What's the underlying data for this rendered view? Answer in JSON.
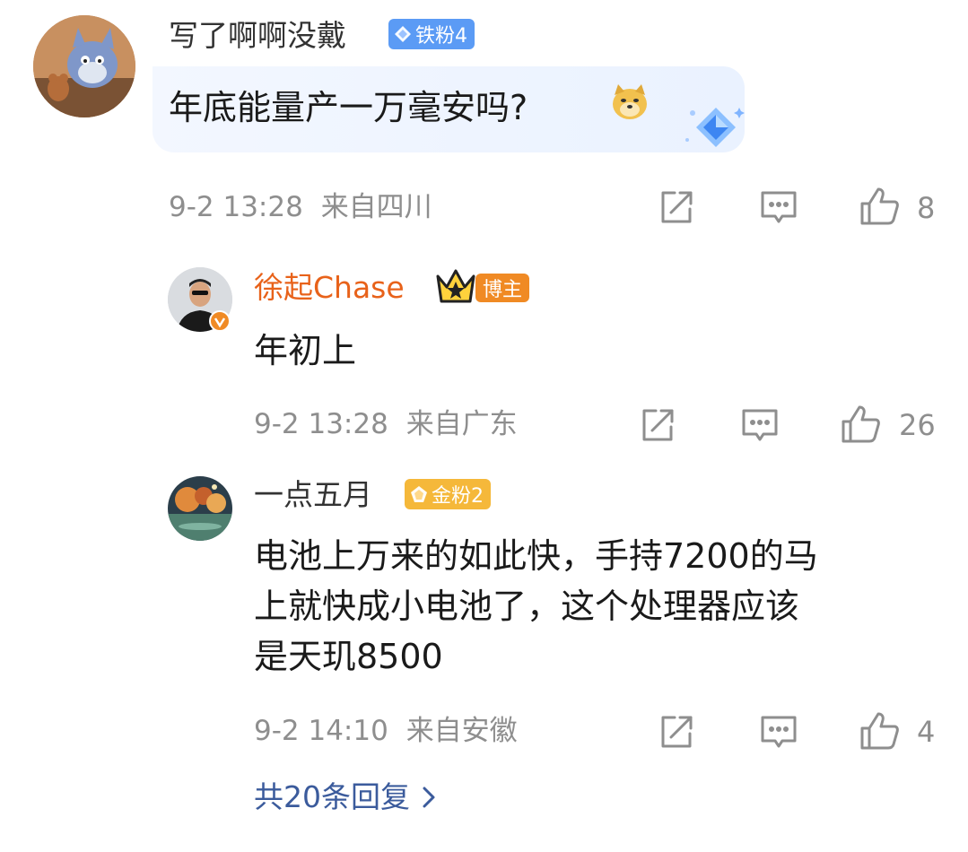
{
  "comments": [
    {
      "user": "写了啊啊没戴",
      "badge": "铁粉4",
      "text": "年底能量产一万毫安吗?",
      "emoji": "doge-emoji",
      "time": "9-2 13:28",
      "location": "来自四川",
      "likes": "8"
    },
    {
      "user": "徐起Chase",
      "badge": "博主",
      "text": "年初上",
      "time": "9-2 13:28",
      "location": "来自广东",
      "likes": "26"
    },
    {
      "user": "一点五月",
      "badge": "金粉2",
      "text_lines": [
        "电池上万来的如此快，手持7200的马",
        "上就快成小电池了，这个处理器应该",
        "是天玑8500"
      ],
      "time": "9-2 14:10",
      "location": "来自安徽",
      "likes": "4"
    }
  ],
  "more_replies": "共20条回复",
  "icons": {
    "share": "share-icon",
    "comment": "comment-icon",
    "like": "thumbs-up-icon",
    "chevron": "chevron-right-icon"
  },
  "colors": {
    "blogger_name": "#e8621a",
    "link": "#3b5b9c",
    "meta": "#8e8e8e",
    "tie_badge": "#5b9bf5",
    "jin_badge": "#f5b83a",
    "bozhu_badge": "#f08a24"
  }
}
